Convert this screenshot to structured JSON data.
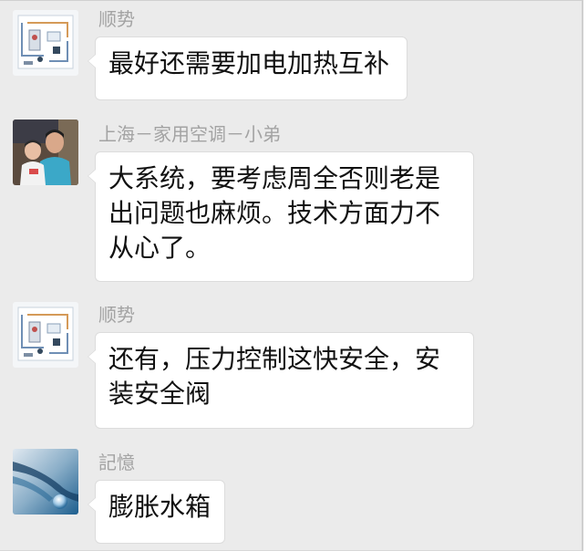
{
  "messages": [
    {
      "sender": "顺势",
      "avatar_icon": "heating-system-diagram-icon",
      "lines": [
        "最好还需要加电加热互补"
      ]
    },
    {
      "sender": "上海－家用空调－小弟",
      "avatar_icon": "father-and-child-photo-icon",
      "lines": [
        "大系统，要考虑周全否则老是",
        "出问题也麻烦。技术方面力不",
        "从心了。"
      ]
    },
    {
      "sender": "顺势",
      "avatar_icon": "heating-system-diagram-icon",
      "lines": [
        "还有，压力控制这快安全，安",
        "装安全阀"
      ]
    },
    {
      "sender": "記憶",
      "avatar_icon": "water-drop-photo-icon",
      "lines": [
        "膨胀水箱"
      ]
    }
  ],
  "colors": {
    "chat_background": "#ebebeb",
    "bubble_background": "#ffffff",
    "sender_name": "#a3a3a3",
    "message_text": "#111111"
  }
}
